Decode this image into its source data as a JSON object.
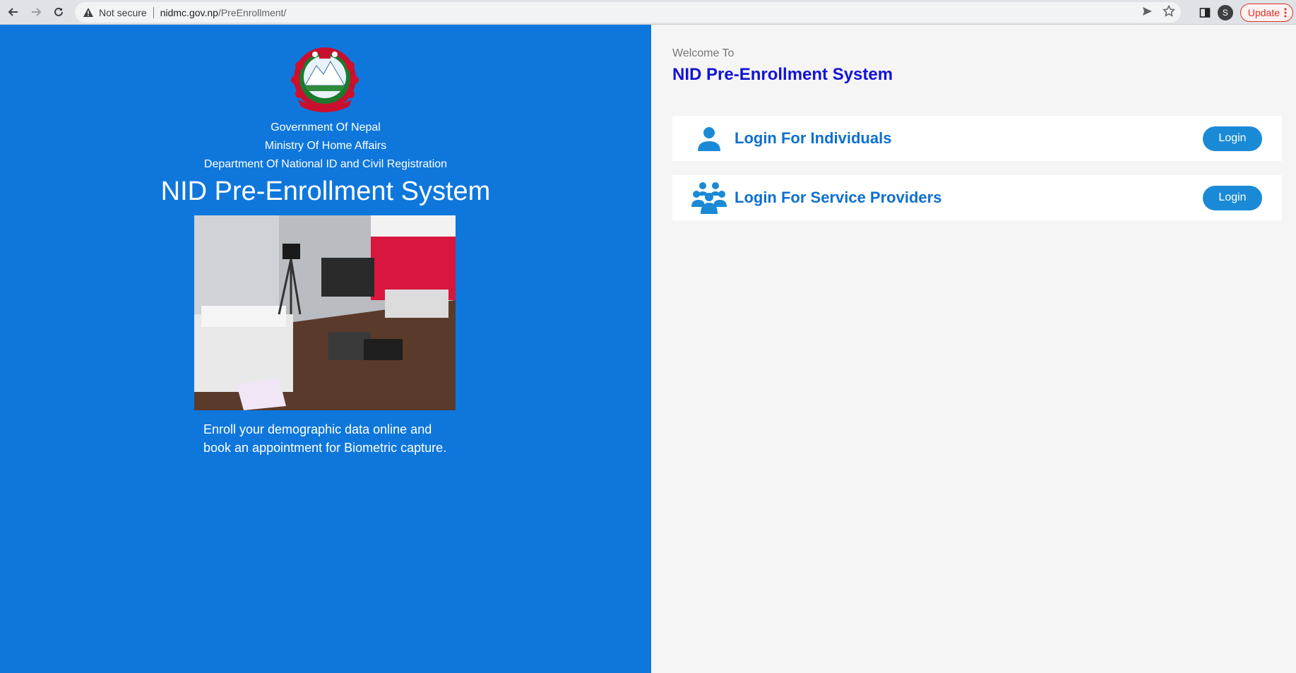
{
  "browser": {
    "not_secure": "Not secure",
    "url_host": "nidmc.gov.np",
    "url_path": "/PreEnrollment/",
    "avatar_letter": "S",
    "update_label": "Update"
  },
  "left": {
    "gov_lines": [
      "Government Of Nepal",
      "Ministry Of Home Affairs",
      "Department Of National ID and Civil Registration"
    ],
    "title": "NID Pre-Enrollment System",
    "tagline_1": "Enroll your demographic data online and",
    "tagline_2": "book an appointment for Biometric capture."
  },
  "right": {
    "welcome": "Welcome To",
    "title": "NID Pre-Enrollment System",
    "cards": [
      {
        "label": "Login For Individuals",
        "button": "Login",
        "icon": "user-icon"
      },
      {
        "label": "Login For Service Providers",
        "button": "Login",
        "icon": "users-group-icon"
      }
    ]
  },
  "colors": {
    "left_bg": "#0f77dc",
    "right_title": "#1212d8",
    "card_label": "#0f6fd0",
    "button_bg": "#1a8ad6"
  }
}
